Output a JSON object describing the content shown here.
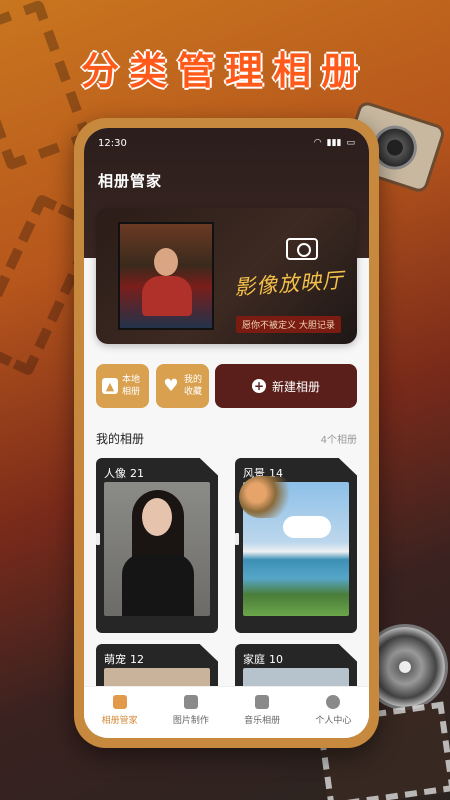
{
  "promo": {
    "headline": "分类管理相册"
  },
  "status_bar": {
    "time": "12:30"
  },
  "header": {
    "title": "相册管家"
  },
  "banner": {
    "title": "影像放映厅",
    "subtitle": "愿你不被定义 大胆记录"
  },
  "quick_actions": {
    "local_album": "本地相册",
    "my_favorites": "我的收藏",
    "new_album": "新建相册"
  },
  "my_albums": {
    "title": "我的相册",
    "count_label": "4个相册",
    "items": [
      {
        "name": "人像",
        "count": "21"
      },
      {
        "name": "风景",
        "count": "14"
      },
      {
        "name": "萌宠",
        "count": "12"
      },
      {
        "name": "家庭",
        "count": "10"
      }
    ]
  },
  "tabs": [
    {
      "label": "相册管家",
      "icon": "home-icon",
      "active": true
    },
    {
      "label": "图片制作",
      "icon": "image-icon",
      "active": false
    },
    {
      "label": "音乐相册",
      "icon": "music-icon",
      "active": false
    },
    {
      "label": "个人中心",
      "icon": "profile-icon",
      "active": false
    }
  ],
  "colors": {
    "accent": "#d9a04f",
    "primary_dark": "#5a1f1a",
    "headline": "#ff5a1a",
    "tab_active": "#e2994a"
  }
}
